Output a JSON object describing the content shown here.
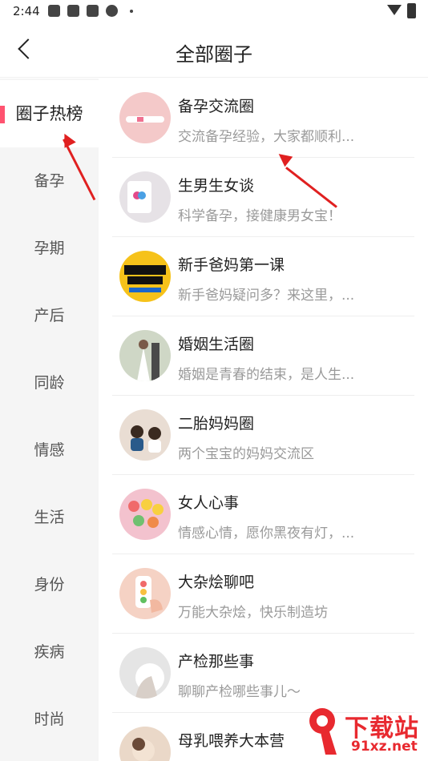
{
  "status_bar": {
    "time": "2:44"
  },
  "header": {
    "title": "全部圈子"
  },
  "sidebar": {
    "items": [
      {
        "label": "圈子热榜",
        "active": true
      },
      {
        "label": "备孕"
      },
      {
        "label": "孕期"
      },
      {
        "label": "产后"
      },
      {
        "label": "同龄"
      },
      {
        "label": "情感"
      },
      {
        "label": "生活"
      },
      {
        "label": "身份"
      },
      {
        "label": "疾病"
      },
      {
        "label": "时尚"
      }
    ]
  },
  "groups": [
    {
      "title": "备孕交流圈",
      "desc": "交流备孕经验，大家都顺利...",
      "avatar_color": "#f4c9c9"
    },
    {
      "title": "生男生女谈",
      "desc": "科学备孕，接健康男女宝！",
      "avatar_color": "#e6e2e6"
    },
    {
      "title": "新手爸妈第一课",
      "desc": "新手爸妈疑问多？来这里，...",
      "avatar_color": "#f6c21a"
    },
    {
      "title": "婚姻生活圈",
      "desc": "婚姻是青春的结束，是人生...",
      "avatar_color": "#cfd7c6"
    },
    {
      "title": "二胎妈妈圈",
      "desc": "两个宝宝的妈妈交流区",
      "avatar_color": "#e9ddd3"
    },
    {
      "title": "女人心事",
      "desc": "情感心情，愿你黑夜有灯，...",
      "avatar_color": "#f3c2ce"
    },
    {
      "title": "大杂烩聊吧",
      "desc": "万能大杂烩，快乐制造坊",
      "avatar_color": "#f5d2c4"
    },
    {
      "title": "产检那些事",
      "desc": "聊聊产检哪些事儿～",
      "avatar_color": "#e5e5e5"
    },
    {
      "title": "母乳喂养大本营",
      "desc": "",
      "avatar_color": "#ead8c8"
    }
  ],
  "watermark": {
    "text": "下载站",
    "url": "91xz.net"
  }
}
